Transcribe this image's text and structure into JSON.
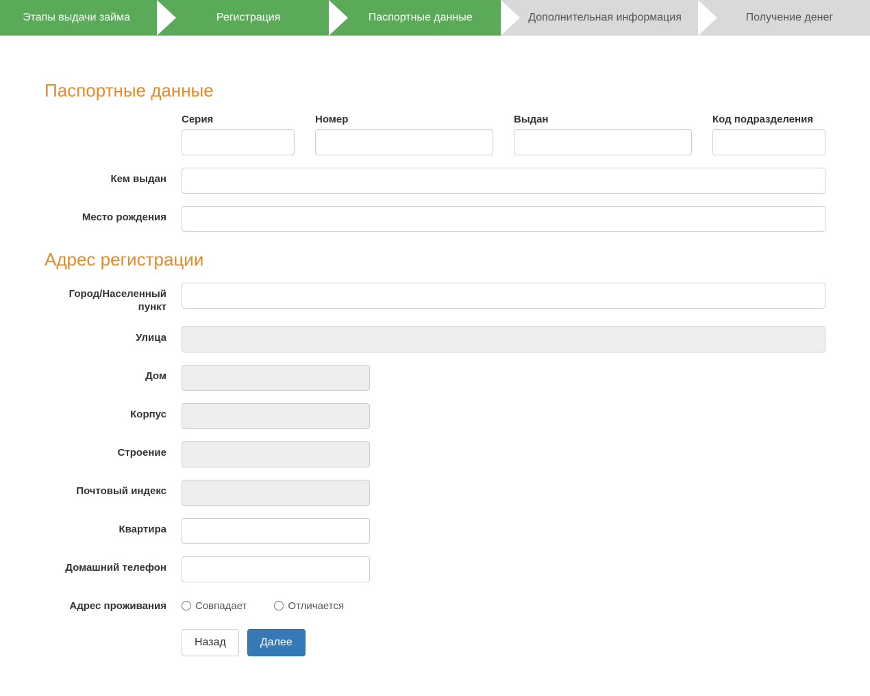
{
  "steps": [
    {
      "label": "Этапы выдачи займа",
      "state": "done"
    },
    {
      "label": "Регистрация",
      "state": "done"
    },
    {
      "label": "Паспортные данные",
      "state": "done"
    },
    {
      "label": "Дополнительная информация",
      "state": "pending"
    },
    {
      "label": "Получение денег",
      "state": "pending"
    }
  ],
  "sections": {
    "passport": "Паспортные данные",
    "address": "Адрес регистрации"
  },
  "passport": {
    "seria_label": "Серия",
    "nomer_label": "Номер",
    "vydan_label": "Выдан",
    "kod_label": "Код подразделения",
    "issued_by_label": "Кем выдан",
    "birthplace_label": "Место рождения",
    "seria": "",
    "nomer": "",
    "vydan": "",
    "kod": "",
    "issued_by": "",
    "birthplace": ""
  },
  "address": {
    "city_label": "Город/Населенный пункт",
    "street_label": "Улица",
    "house_label": "Дом",
    "korpus_label": "Корпус",
    "building_label": "Строение",
    "zip_label": "Почтовый индекс",
    "flat_label": "Квартира",
    "homephone_label": "Домашний телефон",
    "resaddr_label": "Адрес проживания",
    "city": "",
    "street": "",
    "house": "",
    "korpus": "",
    "building": "",
    "zip": "",
    "flat": "",
    "homephone": ""
  },
  "resaddr_options": {
    "same": "Совпадает",
    "diff": "Отличается"
  },
  "buttons": {
    "back": "Назад",
    "next": "Далее"
  }
}
